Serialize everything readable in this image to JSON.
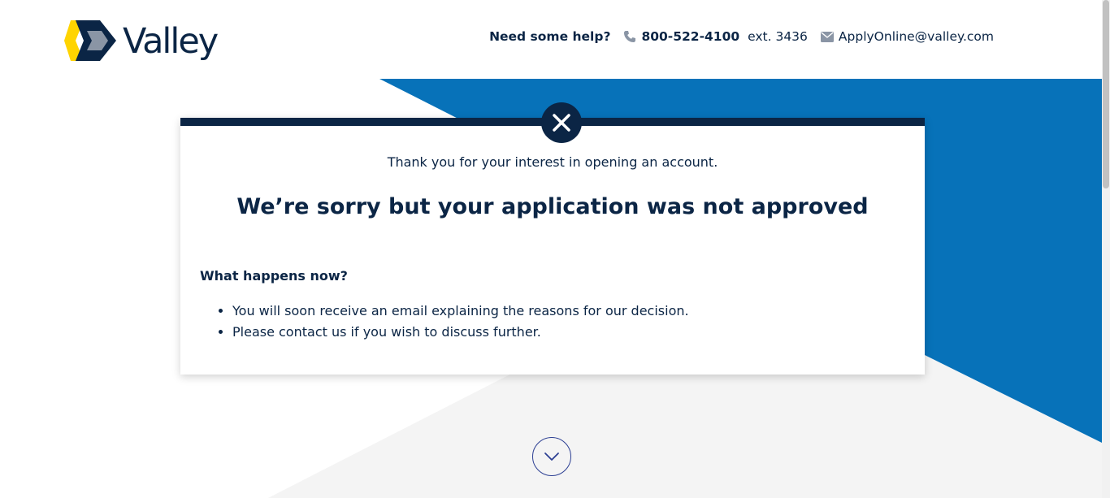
{
  "brand": {
    "name": "Valley",
    "colors": {
      "navy": "#0b2545",
      "blue": "#0772b9",
      "yellow": "#ffd400",
      "gray": "#8a95a5"
    }
  },
  "help": {
    "label": "Need some help?",
    "phone_icon": "phone-icon",
    "phone_number": "800-522-4100",
    "phone_ext": "ext. 3436",
    "email_icon": "envelope-icon",
    "email": "ApplyOnline@valley.com"
  },
  "card": {
    "status_icon": "close-icon",
    "intro": "Thank you for your interest in opening an account.",
    "title": "We’re sorry but your application was not approved",
    "section_heading": "What happens now?",
    "items": [
      "You will soon receive an email explaining the reasons for our decision.",
      "Please contact us if you wish to discuss further."
    ]
  },
  "scroll_down_icon": "chevron-down-icon",
  "background_colors": {
    "blue_panel": "#0772b9",
    "gray_panel": "#f4f4f4"
  }
}
